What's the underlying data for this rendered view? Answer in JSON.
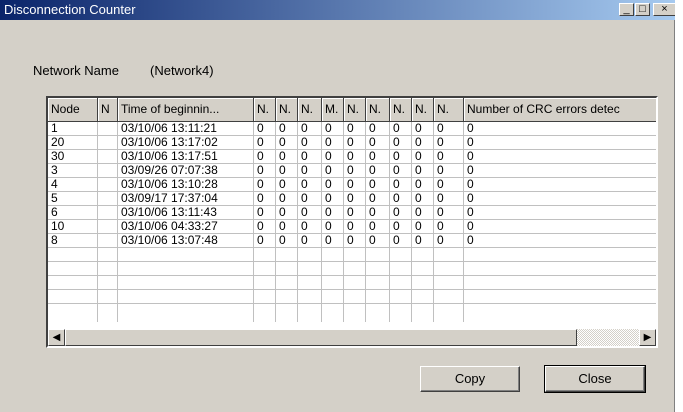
{
  "window": {
    "title": "Disconnection Counter",
    "minimize_icon": "_",
    "maximize_icon": "□",
    "close_icon": "×"
  },
  "network": {
    "label": "Network Name",
    "value": "(Network4)"
  },
  "table": {
    "columns": [
      "Node",
      "N",
      "Time of beginnin...",
      "N.",
      "N.",
      "N.",
      "M.",
      "N.",
      "N.",
      "N.",
      "N.",
      "N.",
      "Number of CRC errors detec"
    ],
    "rows": [
      [
        "1",
        "",
        "03/10/06 13:11:21",
        "0",
        "0",
        "0",
        "0",
        "0",
        "0",
        "0",
        "0",
        "0",
        "0"
      ],
      [
        "20",
        "",
        "03/10/06 13:17:02",
        "0",
        "0",
        "0",
        "0",
        "0",
        "0",
        "0",
        "0",
        "0",
        "0"
      ],
      [
        "30",
        "",
        "03/10/06 13:17:51",
        "0",
        "0",
        "0",
        "0",
        "0",
        "0",
        "0",
        "0",
        "0",
        "0"
      ],
      [
        "3",
        "",
        "03/09/26 07:07:38",
        "0",
        "0",
        "0",
        "0",
        "0",
        "0",
        "0",
        "0",
        "0",
        "0"
      ],
      [
        "4",
        "",
        "03/10/06 13:10:28",
        "0",
        "0",
        "0",
        "0",
        "0",
        "0",
        "0",
        "0",
        "0",
        "0"
      ],
      [
        "5",
        "",
        "03/09/17 17:37:04",
        "0",
        "0",
        "0",
        "0",
        "0",
        "0",
        "0",
        "0",
        "0",
        "0"
      ],
      [
        "6",
        "",
        "03/10/06 13:11:43",
        "0",
        "0",
        "0",
        "0",
        "0",
        "0",
        "0",
        "0",
        "0",
        "0"
      ],
      [
        "10",
        "",
        "03/10/06 04:33:27",
        "0",
        "0",
        "0",
        "0",
        "0",
        "0",
        "0",
        "0",
        "0",
        "0"
      ],
      [
        "8",
        "",
        "03/10/06 13:07:48",
        "0",
        "0",
        "0",
        "0",
        "0",
        "0",
        "0",
        "0",
        "0",
        "0"
      ]
    ],
    "empty_rows": 4
  },
  "scrollbar": {
    "left_icon": "◀",
    "right_icon": "▶"
  },
  "buttons": {
    "copy": "Copy",
    "close": "Close"
  }
}
